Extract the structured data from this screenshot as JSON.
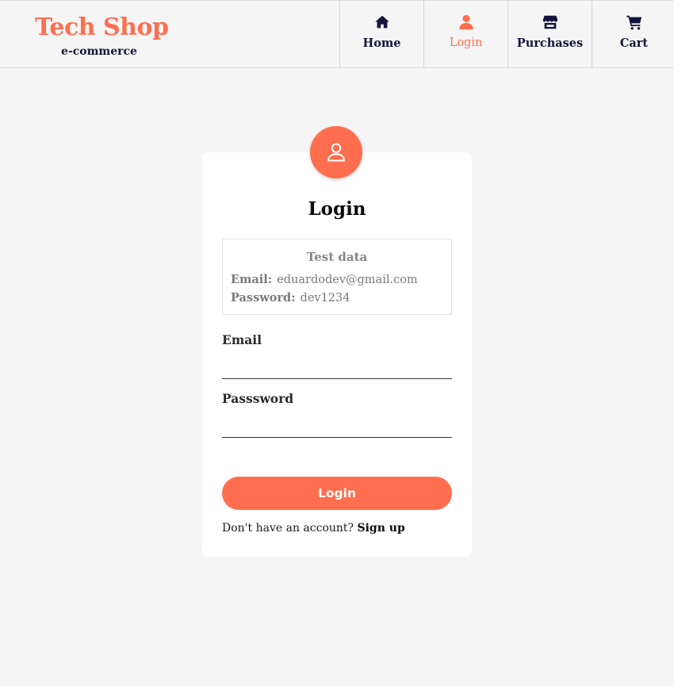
{
  "brand": {
    "title": "Tech Shop",
    "subtitle": "e-commerce"
  },
  "nav": {
    "items": [
      {
        "label": "Home",
        "icon": "home-icon",
        "active": false
      },
      {
        "label": "Login",
        "icon": "user-icon",
        "active": true
      },
      {
        "label": "Purchases",
        "icon": "store-icon",
        "active": false
      },
      {
        "label": "Cart",
        "icon": "cart-icon",
        "active": false
      }
    ]
  },
  "login": {
    "title": "Login",
    "avatar_icon": "user-outline-icon",
    "test_data": {
      "title": "Test data",
      "email_label": "Email:",
      "email_value": "eduardodev@gmail.com",
      "password_label": "Password:",
      "password_value": "dev1234"
    },
    "email_label": "Email",
    "email_value": "",
    "password_label": "Passsword",
    "password_value": "",
    "submit_label": "Login",
    "signup_prompt": "Don't have an account?",
    "signup_link": "Sign up"
  },
  "colors": {
    "accent": "#ff6e4e",
    "navy": "#12143a",
    "background": "#f5f5f5",
    "card": "#ffffff"
  }
}
